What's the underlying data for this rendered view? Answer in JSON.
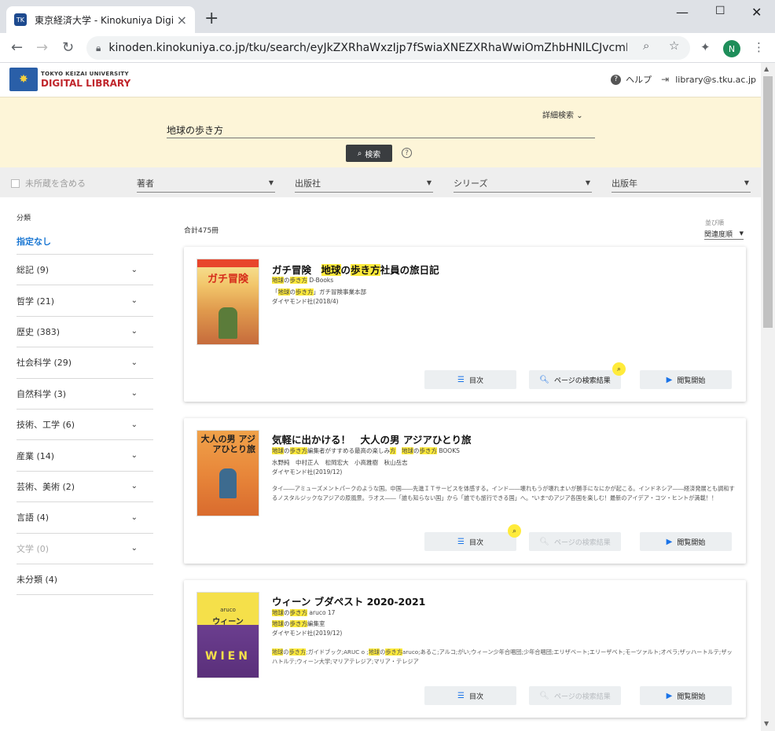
{
  "browser": {
    "tab_title": "東京経済大学 - Kinokuniya Digital",
    "url": "kinoden.kinokuniya.co.jp/tku/search/eyJkZXRhaWxzIjp7fSwiaXNEZXRhaWwiOmZhbHNlLCJvcmRlckJ5U2N...",
    "profile_initial": "N"
  },
  "header": {
    "logo_top": "TOKYO KEIZAI UNIVERSITY",
    "logo_bottom": "DIGITAL LIBRARY",
    "help": "ヘルプ",
    "account": "library@s.tku.ac.jp"
  },
  "search": {
    "advanced": "詳細検索",
    "query": "地球の歩き方",
    "button": "検索"
  },
  "filters": {
    "include_unowned": "未所蔵を含める",
    "author": "著者",
    "publisher": "出版社",
    "series": "シリーズ",
    "year": "出版年"
  },
  "sidebar": {
    "heading": "分類",
    "none": "指定なし",
    "items": [
      {
        "label": "総記 (9)"
      },
      {
        "label": "哲学 (21)"
      },
      {
        "label": "歴史 (383)"
      },
      {
        "label": "社会科学 (29)"
      },
      {
        "label": "自然科学 (3)"
      },
      {
        "label": "技術、工学 (6)"
      },
      {
        "label": "産業 (14)"
      },
      {
        "label": "芸術、美術 (2)"
      },
      {
        "label": "言語 (4)"
      },
      {
        "label": "文学 (0)"
      },
      {
        "label": "未分類 (4)"
      }
    ]
  },
  "results": {
    "total": "合計475冊",
    "sort_label": "並び順",
    "sort_value": "関連度順",
    "buttons": {
      "toc": "目次",
      "page_search": "ページの検索結果",
      "read": "閲覧開始"
    },
    "books": [
      {
        "title_a": "ガチ冒険　",
        "title_hl1": "地球",
        "title_b": "の",
        "title_hl2": "歩き方",
        "title_c": "社員の旅日記",
        "series_hl1": "地球",
        "series_b": "の",
        "series_hl2": "歩き方",
        "series_c": " D-Books",
        "author_a": "「",
        "author_hl1": "地球",
        "author_b": "の",
        "author_hl2": "歩き方",
        "author_c": "」ガチ冒険事業本部",
        "publisher": "ダイヤモンド社(2018/4)",
        "cover_text": "ガチ冒険"
      },
      {
        "title": "気軽に出かける！　大人の男 アジアひとり旅",
        "series_hl1": "地球",
        "series_b": "の",
        "series_hl2": "歩き方",
        "series_c": "編集者がすすめる最高の楽しみ",
        "series_hl3": "方",
        "series_d": "　",
        "series_hl4": "地球",
        "series_e": "の",
        "series_hl5": "歩き方",
        "series_f": " BOOKS",
        "authors": "水野純　中村正人　松岡宏大　小高雅樹　秋山岳志",
        "publisher": "ダイヤモンド社(2019/12)",
        "description": "タイ――アミューズメントパークのような国。中国――先進ＩＴサービスを体感する。インド――壊れもうが壊れまいが勝手になにかが起こる。インドネシア――経済発展とも調和するノスタルジックなアジアの原風景。ラオス――「誰も知らない国」から「誰でも旅行できる国」へ。\"いま\"のアジア各国を楽しむ！最新のアイデア・コツ・ヒントが満載！！",
        "cover_text": "大人の男 アジアひとり旅"
      },
      {
        "title": "ウィーン ブダペスト 2020-2021",
        "series_hl1": "地球",
        "series_b": "の",
        "series_hl2": "歩き方",
        "series_c": " aruco 17",
        "author_hl1": "地球",
        "author_b": "の",
        "author_hl2": "歩き方",
        "author_c": "編集室",
        "publisher": "ダイヤモンド社(2019/12)",
        "kw_hl1": "地球",
        "kw_b": "の",
        "kw_hl2": "歩き方",
        "kw_c": ";ガイドブック;ARUC o ;",
        "kw_hl3": "地球",
        "kw_d": "の",
        "kw_hl4": "歩き方",
        "kw_e": "aruco;あるこ;アルコ;がい;ウィーン少年合唱団;少年合唱団;エリザベート;エリーザベト;モーツァルト;オペラ;ザッハートルテ;ザッハトルテ;ウィーン大学;マリアテレジア;マリア・テレジア",
        "cover_text": "ウィーン"
      }
    ]
  },
  "colors": {
    "search_band": "#fdf5d8",
    "highlight": "#ffeb3b",
    "link_blue": "#1976d2",
    "brand_red": "#c0262c"
  }
}
